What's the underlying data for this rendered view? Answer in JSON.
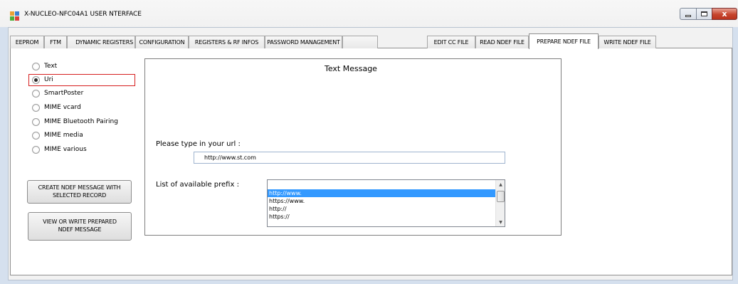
{
  "window": {
    "title": "X-NUCLEO-NFC04A1 USER NTERFACE",
    "icon": "app-icon",
    "controls": [
      "minimize-icon",
      "maximize-icon",
      "close-icon"
    ],
    "close_glyph": "x"
  },
  "tabs": [
    {
      "label": "EEPROM"
    },
    {
      "label": "FTM"
    },
    {
      "label": "DYNAMIC REGISTERS"
    },
    {
      "label": "CONFIGURATION"
    },
    {
      "label": "REGISTERS & RF INFOS"
    },
    {
      "label": "PASSWORD MANAGEMENT"
    },
    {
      "label": ""
    },
    {
      "label": "EDIT CC FILE"
    },
    {
      "label": "READ NDEF FILE"
    },
    {
      "label": "PREPARE NDEF FILE",
      "active": true
    },
    {
      "label": "WRITE NDEF FILE"
    }
  ],
  "record_types": {
    "selected": "Uri",
    "options": [
      "Text",
      "Uri",
      "SmartPoster",
      "MIME vcard",
      "MIME Bluetooth Pairing",
      "MIME media",
      "MIME various"
    ]
  },
  "buttons": {
    "create": "CREATE NDEF MESSAGE WITH SELECTED RECORD",
    "view": "VIEW OR WRITE PREPARED NDEF MESSAGE"
  },
  "panel": {
    "title": "Text Message",
    "url_label": "Please type in your url :",
    "url_value": "http://www.st.com",
    "prefix_label": "List of available prefix :",
    "prefixes": [
      "http://www.",
      "https://www.",
      "http://",
      "https://"
    ],
    "selected_prefix": "http://www."
  },
  "colors": {
    "selection": "#3399ff",
    "highlight_border": "#d62020",
    "window_frame": "#d5e0ee"
  }
}
